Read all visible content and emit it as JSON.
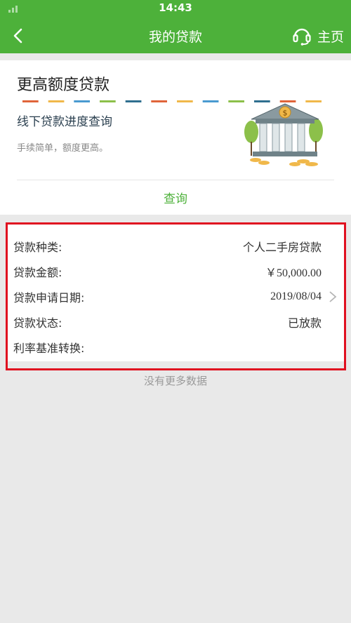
{
  "status_bar": {
    "time": "14:43"
  },
  "header": {
    "title": "我的贷款",
    "home_label": "主页",
    "home_icon": "headset-icon",
    "back_icon": "chevron-left-icon"
  },
  "promo": {
    "title": "更高额度贷款",
    "progress_title": "线下贷款进度查询",
    "subtitle": "手续简单，额度更高。",
    "query_label": "查询",
    "dash_colors": [
      "#e0643a",
      "#f0b84a",
      "#4a9ad0",
      "#8cc04a",
      "#2f6f8f",
      "#e0643a",
      "#f0b84a",
      "#4a9ad0",
      "#8cc04a",
      "#2f6f8f",
      "#e0643a",
      "#f0b84a"
    ],
    "illustration_icon": "bank-building-icon"
  },
  "loan": {
    "rows": [
      {
        "label": "贷款种类:",
        "value": "个人二手房贷款"
      },
      {
        "label": "贷款金额:",
        "value": "￥50,000.00"
      },
      {
        "label": "贷款申请日期:",
        "value": "2019/08/04"
      },
      {
        "label": "贷款状态:",
        "value": "已放款"
      },
      {
        "label": "利率基准转换:",
        "value": ""
      }
    ],
    "highlight_color": "#e01020"
  },
  "footer": {
    "no_more": "没有更多数据"
  },
  "colors": {
    "primary": "#4db13a"
  }
}
